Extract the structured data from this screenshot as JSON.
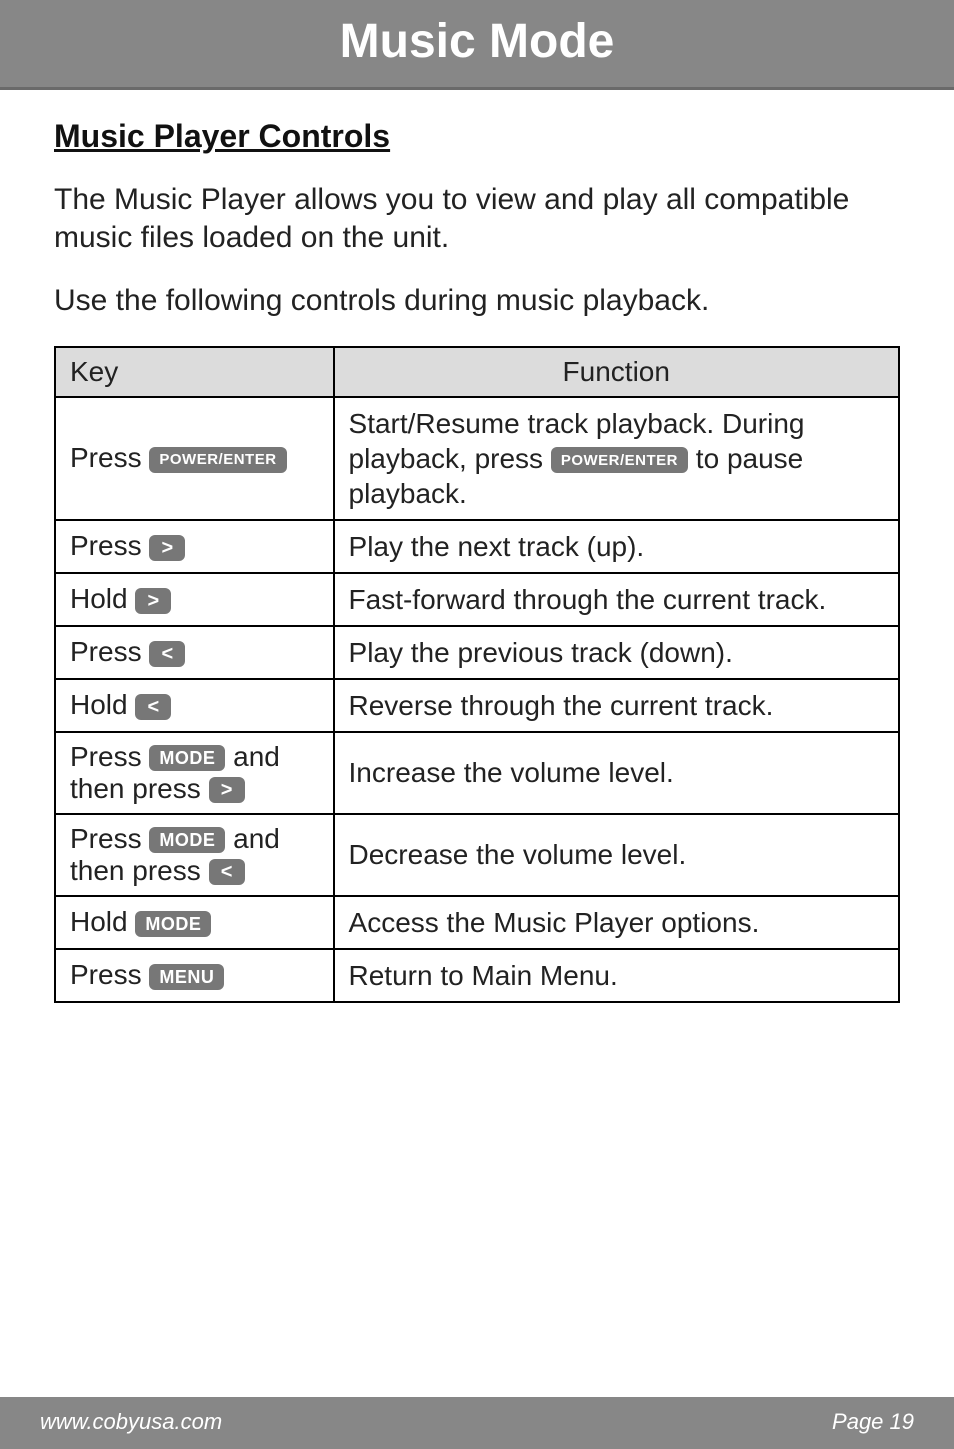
{
  "title": "Music Mode",
  "section_heading": "Music Player Controls",
  "intro_para": "The Music Player allows you to view and play all compatible music files loaded on the unit.",
  "usage_para": "Use the following controls during music playback.",
  "table": {
    "header_key": "Key",
    "header_function": "Function",
    "rows": [
      {
        "key_prefix": "Press ",
        "key_buttons": [
          "POWER/ENTER"
        ],
        "key_suffix": "",
        "func_parts": [
          "Start/Resume track playback. During playback, press ",
          "POWER/ENTER",
          " to pause playback."
        ]
      },
      {
        "key_prefix": "Press ",
        "key_buttons": [
          ">"
        ],
        "key_suffix": "",
        "func_parts": [
          "Play the next track (up)."
        ]
      },
      {
        "key_prefix": "Hold ",
        "key_buttons": [
          ">"
        ],
        "key_suffix": "",
        "func_parts": [
          "Fast-forward through the current track."
        ]
      },
      {
        "key_prefix": "Press ",
        "key_buttons": [
          "<"
        ],
        "key_suffix": "",
        "func_parts": [
          "Play the previous track (down)."
        ]
      },
      {
        "key_prefix": "Hold ",
        "key_buttons": [
          "<"
        ],
        "key_suffix": "",
        "func_parts": [
          "Reverse through the current track."
        ]
      },
      {
        "key_prefix": "Press ",
        "key_buttons": [
          "MODE"
        ],
        "key_mid": " and then press ",
        "key_buttons2": [
          ">"
        ],
        "func_parts": [
          "Increase the volume level."
        ]
      },
      {
        "key_prefix": "Press ",
        "key_buttons": [
          "MODE"
        ],
        "key_mid": " and then press ",
        "key_buttons2": [
          "<"
        ],
        "func_parts": [
          "Decrease the volume level."
        ]
      },
      {
        "key_prefix": "Hold ",
        "key_buttons": [
          "MODE"
        ],
        "key_suffix": "",
        "func_parts": [
          "Access the Music Player options."
        ]
      },
      {
        "key_prefix": "Press ",
        "key_buttons": [
          "MENU"
        ],
        "key_suffix": "",
        "func_parts": [
          "Return to Main Menu."
        ]
      }
    ]
  },
  "footer": {
    "left": "www.cobyusa.com",
    "right": "Page 19"
  }
}
